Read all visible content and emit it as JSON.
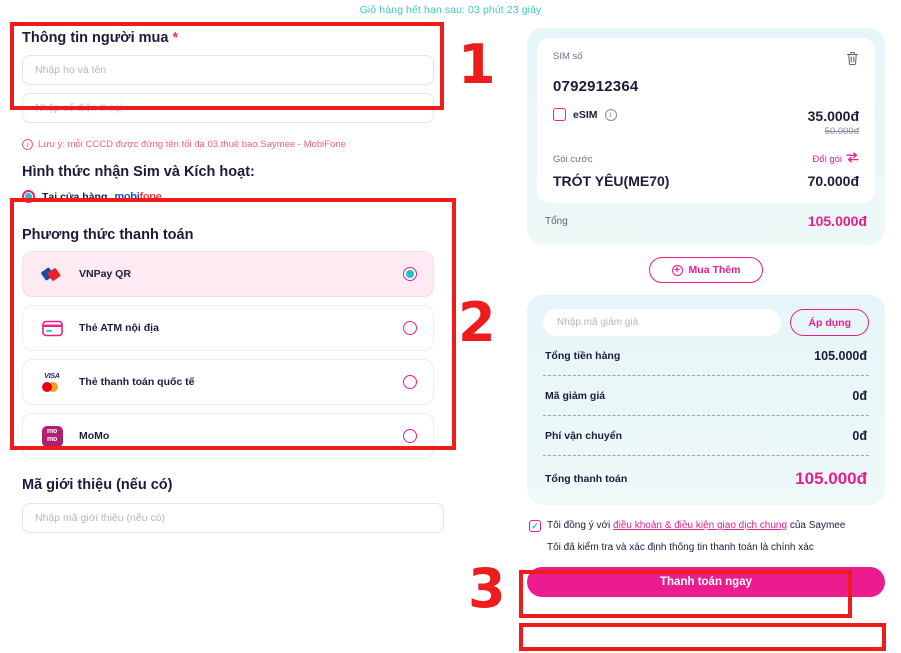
{
  "expiry": {
    "text": "Giỏ hàng hết hạn sau: 03 phút 23 giây",
    "color": "#3fc9c4"
  },
  "buyer": {
    "title": "Thông tin người mua",
    "required_mark": "*",
    "name_placeholder": "Nhập họ và tên",
    "phone_placeholder": "Nhập số điện thoại",
    "note_icon": "info-icon",
    "note": "Lưu ý: mỗi CCCD được đứng tên tối đa 03 thuê bao Saymee - MobiFone"
  },
  "delivery": {
    "title": "Hình thức nhận Sim và Kích hoạt:",
    "option_label": "Tại cửa hàng",
    "brand_prefix": "mobi",
    "brand_suffix": "fone",
    "selected": true
  },
  "payment": {
    "title": "Phương thức thanh toán",
    "methods": [
      {
        "label": "VNPay QR",
        "icon": "vnpay-icon",
        "selected": true
      },
      {
        "label": "Thẻ ATM nội địa",
        "icon": "atm-card-icon",
        "selected": false
      },
      {
        "label": "Thẻ thanh toán quốc tế",
        "icon": "visa-mastercard-icon",
        "selected": false
      },
      {
        "label": "MoMo",
        "icon": "momo-icon",
        "selected": false
      }
    ]
  },
  "referral": {
    "title": "Mã giới thiệu (nếu có)",
    "placeholder": "Nhập mã giới thiệu (nếu có)"
  },
  "cart": {
    "sim_label": "SIM số",
    "sim_number": "0792912364",
    "delete_icon": "trash-icon",
    "esim_label": "eSIM",
    "esim_info_icon": "info-icon",
    "esim_checked": false,
    "sim_price": "35.000đ",
    "sim_price_old": "50.000đ",
    "package_label": "Gói cước",
    "swap_label": "Đổi gói",
    "swap_icon": "swap-arrows-icon",
    "package_name": "TRÓT YÊU(ME70)",
    "package_price": "70.000đ",
    "total_label": "Tổng",
    "total_value": "105.000đ",
    "buy_more_label": "Mua Thêm",
    "buy_more_icon": "plus-circle-icon"
  },
  "summary": {
    "promo_placeholder": "Nhập mã giảm giá",
    "apply_label": "Áp dụng",
    "rows": [
      {
        "label": "Tổng tiền hàng",
        "value": "105.000đ"
      },
      {
        "label": "Mã giảm giá",
        "value": "0đ"
      },
      {
        "label": "Phí vận chuyển",
        "value": "0đ"
      },
      {
        "label": "Tổng thanh toán",
        "value": "105.000đ"
      }
    ]
  },
  "terms": {
    "prefix": "Tôi đồng ý với ",
    "link": "điều khoản & điều kiện giao dịch chung",
    "suffix": " của Saymee",
    "second_line": "Tôi đã kiểm tra và xác định thông tin thanh toán là chính xác",
    "checked": true,
    "pay_button": "Thanh toán ngay"
  },
  "annotations": {
    "one": "1",
    "two": "2",
    "three": "3",
    "color": "#ef1c1c"
  },
  "colors": {
    "accent": "#ec1b8e",
    "teal": "#1fc5c0",
    "panel": "#e6f6f8"
  }
}
